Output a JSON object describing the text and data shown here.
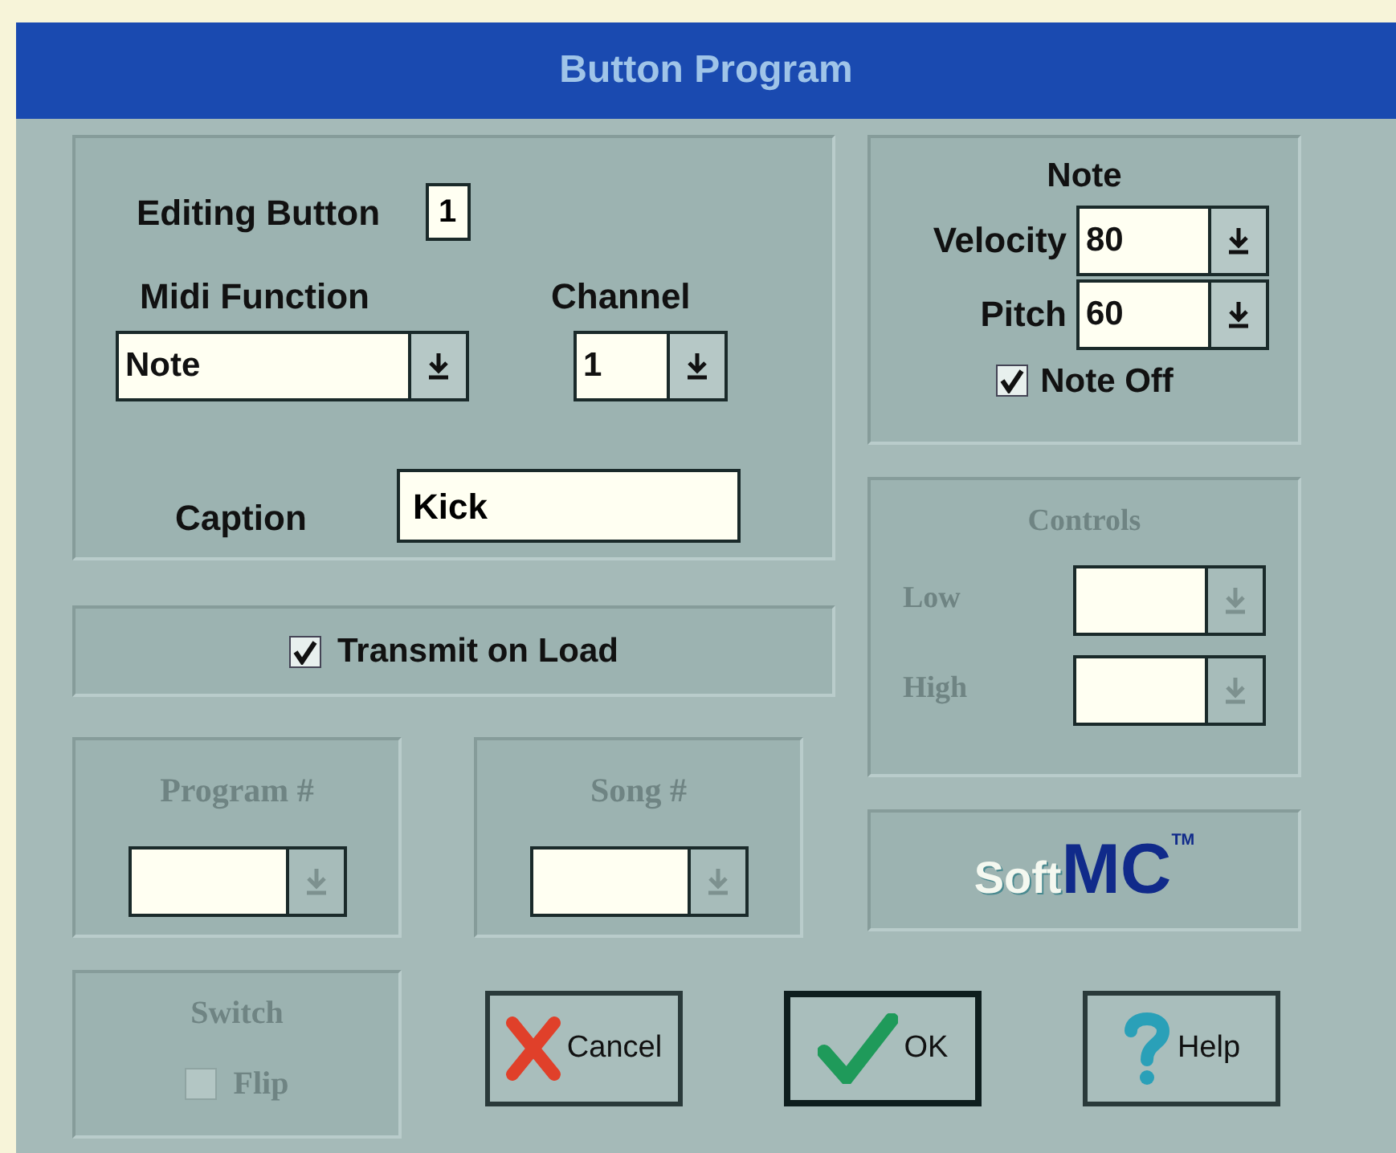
{
  "window": {
    "title": "Button Program"
  },
  "editing": {
    "label": "Editing Button",
    "value": "1"
  },
  "midi_function": {
    "label": "Midi Function",
    "value": "Note"
  },
  "channel": {
    "label": "Channel",
    "value": "1"
  },
  "caption": {
    "label": "Caption",
    "value": "Kick"
  },
  "transmit_on_load": {
    "label": "Transmit on Load",
    "checked": true
  },
  "program": {
    "label": "Program #",
    "disabled": true
  },
  "song": {
    "label": "Song #",
    "disabled": true
  },
  "note": {
    "title": "Note",
    "velocity": {
      "label": "Velocity",
      "value": "80"
    },
    "pitch": {
      "label": "Pitch",
      "value": "60"
    },
    "note_off": {
      "label": "Note Off",
      "checked": true
    }
  },
  "controls": {
    "title": "Controls",
    "disabled": true,
    "low": {
      "label": "Low"
    },
    "high": {
      "label": "High"
    }
  },
  "logo": {
    "soft": "Soft",
    "mc": "MC",
    "tm": "TM"
  },
  "switch": {
    "title": "Switch",
    "disabled": true,
    "flip": {
      "label": "Flip",
      "checked": false
    }
  },
  "buttons": [
    {
      "kind": "cancel",
      "label": "Cancel",
      "default": false
    },
    {
      "kind": "ok",
      "label": "OK",
      "default": true
    },
    {
      "kind": "help",
      "label": "Help",
      "default": false
    }
  ]
}
